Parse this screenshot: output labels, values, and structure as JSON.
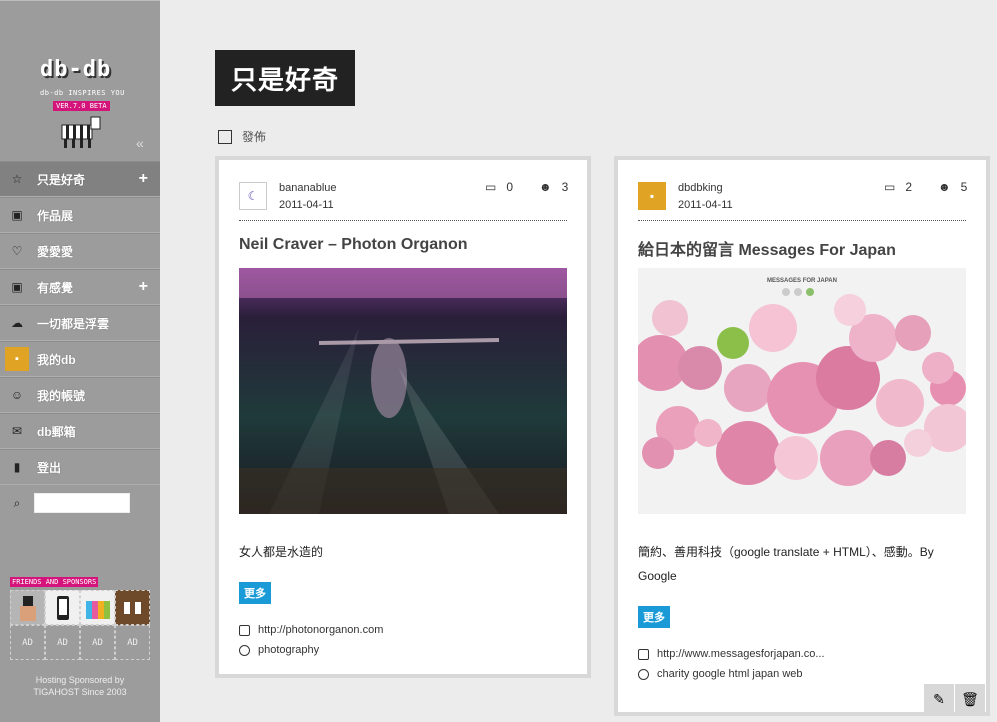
{
  "sidebar": {
    "logo": "db-db",
    "tagline": "db-db INSPIRES YOU",
    "version": "VER.7.0 BETA",
    "collapse": "«",
    "items": [
      {
        "label": "只是好奇",
        "icon": "star-icon",
        "plus": "+"
      },
      {
        "label": "作品展",
        "icon": "gallery-icon",
        "plus": ""
      },
      {
        "label": "愛愛愛",
        "icon": "heart-icon",
        "plus": ""
      },
      {
        "label": "有感覺",
        "icon": "gallery-icon",
        "plus": "+"
      },
      {
        "label": "一切都是浮雲",
        "icon": "cloud-icon",
        "plus": ""
      },
      {
        "label": "我的db",
        "icon": "db-icon",
        "plus": ""
      },
      {
        "label": "我的帳號",
        "icon": "user-icon",
        "plus": ""
      },
      {
        "label": "db郵箱",
        "icon": "mail-icon",
        "plus": ""
      },
      {
        "label": "登出",
        "icon": "logout-icon",
        "plus": ""
      }
    ],
    "sponsors_title": "FRIENDS AND SPONSORS",
    "ad_label": "AD",
    "hosting_line1": "Hosting Sponsored by",
    "hosting_line2": "TIGAHOST Since 2003"
  },
  "main": {
    "title": "只是好奇",
    "post_label": "發佈"
  },
  "cards": [
    {
      "author": "bananablue",
      "date": "2011-04-11",
      "comments": "0",
      "likes": "3",
      "title": "Neil Craver – Photon Organon",
      "description": "女人都是水造的",
      "more": "更多",
      "url": "http://photonorganon.com",
      "tags": "photography"
    },
    {
      "author": "dbdbking",
      "date": "2011-04-11",
      "comments": "2",
      "likes": "5",
      "title": "給日本的留言 Messages For Japan",
      "description": "簡約、善用科技（google translate + HTML）、感動。By Google",
      "more": "更多",
      "url": "http://www.messagesforjapan.co...",
      "tags": "charity google html japan web",
      "image_header": "MESSAGES FOR JAPAN"
    }
  ],
  "colors": {
    "accent": "#1a9ad7",
    "brand_pink": "#d4147a",
    "db_orange": "#e0a323"
  }
}
